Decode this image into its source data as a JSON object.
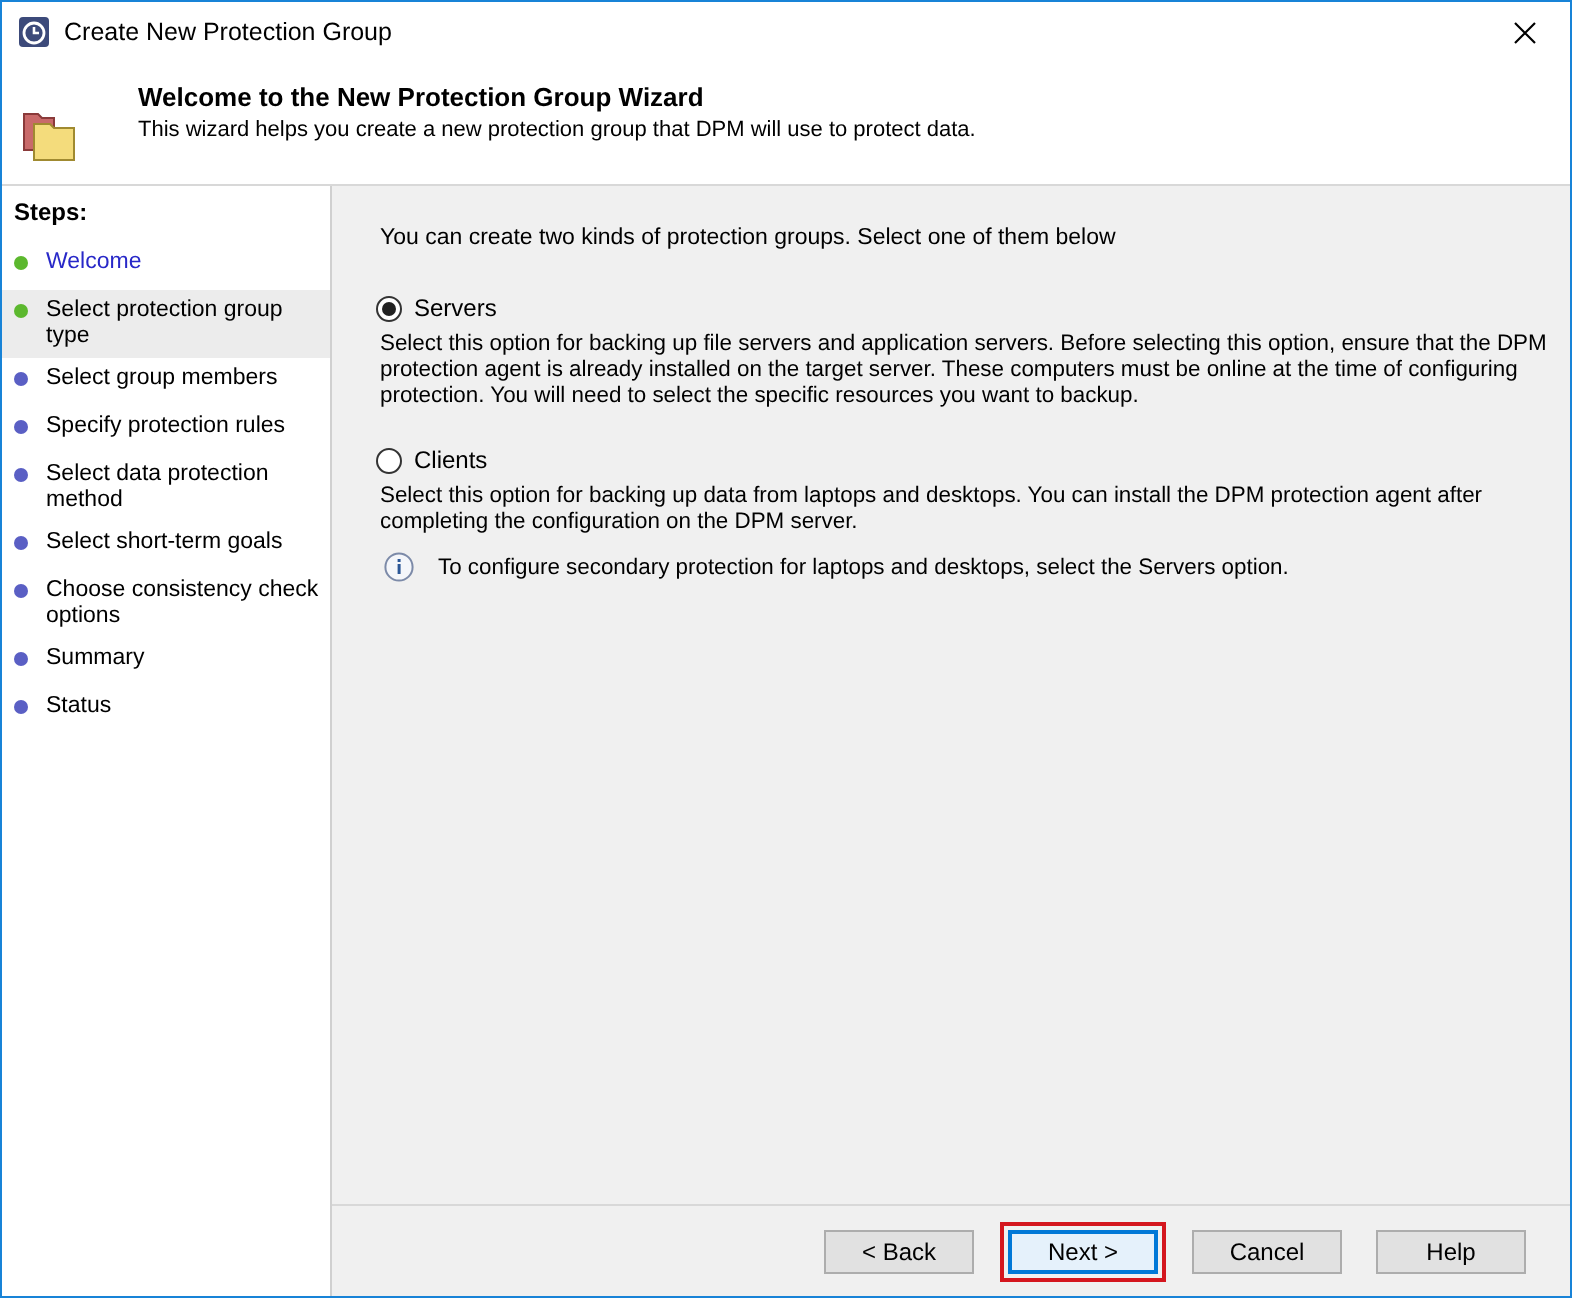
{
  "window": {
    "title": "Create New Protection Group"
  },
  "header": {
    "title": "Welcome to the New Protection Group Wizard",
    "subtitle": "This wizard helps you create a new protection group that DPM will use to protect data."
  },
  "steps": {
    "heading": "Steps:",
    "items": [
      {
        "label": "Welcome",
        "color": "#5cb82e",
        "selected": false,
        "kind": "link"
      },
      {
        "label": "Select protection group type",
        "color": "#5cb82e",
        "selected": true,
        "kind": "text"
      },
      {
        "label": "Select group members",
        "color": "#5a5fc4",
        "selected": false,
        "kind": "text"
      },
      {
        "label": "Specify protection rules",
        "color": "#5a5fc4",
        "selected": false,
        "kind": "text"
      },
      {
        "label": "Select data protection method",
        "color": "#5a5fc4",
        "selected": false,
        "kind": "text"
      },
      {
        "label": "Select short-term goals",
        "color": "#5a5fc4",
        "selected": false,
        "kind": "text"
      },
      {
        "label": "Choose consistency check options",
        "color": "#5a5fc4",
        "selected": false,
        "kind": "text"
      },
      {
        "label": "Summary",
        "color": "#5a5fc4",
        "selected": false,
        "kind": "text"
      },
      {
        "label": "Status",
        "color": "#5a5fc4",
        "selected": false,
        "kind": "text"
      }
    ]
  },
  "intro": "You can create two kinds of protection groups. Select one of them below",
  "options": [
    {
      "label": "Servers",
      "selected": true,
      "description": "Select this option for backing up file servers and application servers. Before selecting this option, ensure that the DPM protection agent is already installed on the target server. These computers must be online at the time of configuring protection. You will need to select the specific resources you want to backup."
    },
    {
      "label": "Clients",
      "selected": false,
      "description": "Select this option for backing up data from laptops and desktops. You can install the DPM protection agent after completing the configuration on the DPM server.",
      "note": "To configure secondary protection for laptops and desktops, select the Servers option."
    }
  ],
  "buttons": [
    {
      "label": "< Back",
      "focused": false,
      "highlighted": false
    },
    {
      "label": "Next >",
      "focused": true,
      "highlighted": true
    },
    {
      "label": "Cancel",
      "focused": false,
      "highlighted": false
    },
    {
      "label": "Help",
      "focused": false,
      "highlighted": false
    }
  ]
}
